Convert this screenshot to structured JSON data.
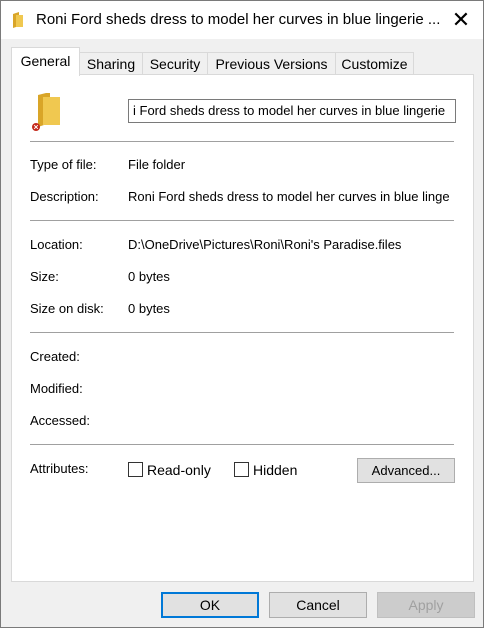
{
  "window": {
    "title": "Roni Ford sheds dress to model her curves in blue lingerie ...",
    "close_glyph": "✕"
  },
  "tabs": [
    {
      "label": "General",
      "active": true
    },
    {
      "label": "Sharing",
      "active": false
    },
    {
      "label": "Security",
      "active": false
    },
    {
      "label": "Previous Versions",
      "active": false
    },
    {
      "label": "Customize",
      "active": false
    }
  ],
  "general": {
    "folder_name": "i Ford sheds dress to model her curves in blue lingerie",
    "type_label": "Type of file:",
    "type_value": "File folder",
    "description_label": "Description:",
    "description_value": "Roni Ford sheds dress to model her curves in blue linge",
    "location_label": "Location:",
    "location_value": "D:\\OneDrive\\Pictures\\Roni\\Roni's Paradise.files",
    "size_label": "Size:",
    "size_value": "0 bytes",
    "size_on_disk_label": "Size on disk:",
    "size_on_disk_value": "0 bytes",
    "created_label": "Created:",
    "modified_label": "Modified:",
    "accessed_label": "Accessed:",
    "attributes_label": "Attributes:",
    "readonly_label": "Read-only",
    "hidden_label": "Hidden",
    "advanced_label": "Advanced..."
  },
  "buttons": {
    "ok": "OK",
    "cancel": "Cancel",
    "apply": "Apply"
  },
  "colors": {
    "folder": "#e8b840",
    "folder_dark": "#d9a528",
    "accent": "#0078d7",
    "sync_badge": "#c42b1c"
  },
  "icons": {
    "title": "folder-icon",
    "main": "folder-icon",
    "badge": "sync-error-icon"
  }
}
